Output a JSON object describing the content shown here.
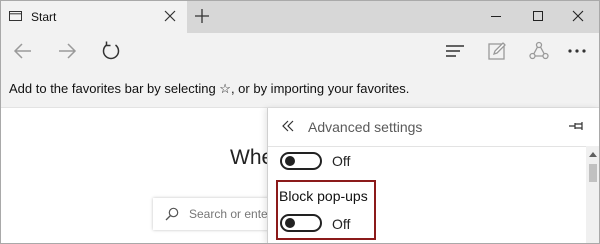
{
  "tab": {
    "title": "Start"
  },
  "favorites_bar": {
    "message": "Add to the favorites bar by selecting ☆, or by importing your favorites."
  },
  "page": {
    "heading": "Whe",
    "search_placeholder": "Search or ente"
  },
  "settings_panel": {
    "title": "Advanced settings",
    "toggle_above": {
      "state": "Off"
    },
    "block_popups": {
      "label": "Block pop-ups",
      "state": "Off"
    }
  },
  "colors": {
    "highlight_border": "#8b1a1a",
    "chrome": "#f2f2f2",
    "titlebar": "#d7d7d7"
  }
}
